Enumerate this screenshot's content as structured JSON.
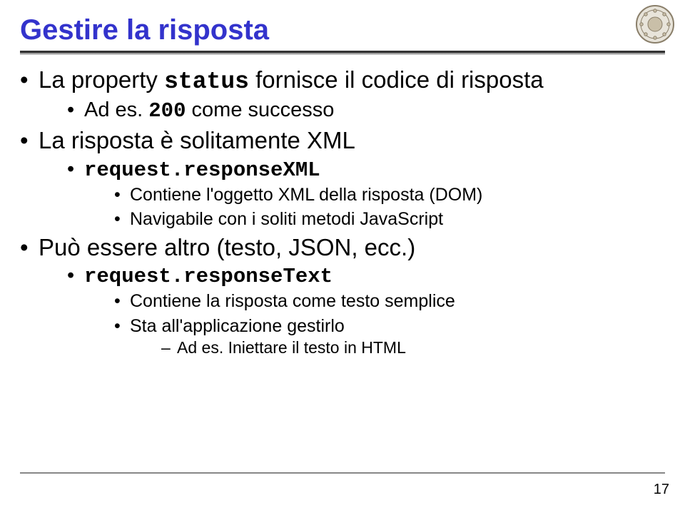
{
  "title": "Gestire la risposta",
  "bullets": {
    "b1a": "La property ",
    "b1_code": "status",
    "b1b": " fornisce il codice di risposta",
    "b1_sub_a": "Ad es. ",
    "b1_sub_code": "200",
    "b1_sub_b": " come successo",
    "b2": "La risposta è solitamente XML",
    "b2_sub_code": "request.responseXML",
    "b2_sub2a": "Contiene l'oggetto XML della risposta (DOM)",
    "b2_sub2b": "Navigabile con i soliti metodi JavaScript",
    "b3": "Può essere altro (testo, JSON, ecc.)",
    "b3_sub_code": "request.responseText",
    "b3_sub2a": "Contiene la risposta come testo semplice",
    "b3_sub2b": "Sta all'applicazione gestirlo",
    "b3_sub3a": "Ad es. Iniettare il testo in HTML"
  },
  "page_number": "17"
}
